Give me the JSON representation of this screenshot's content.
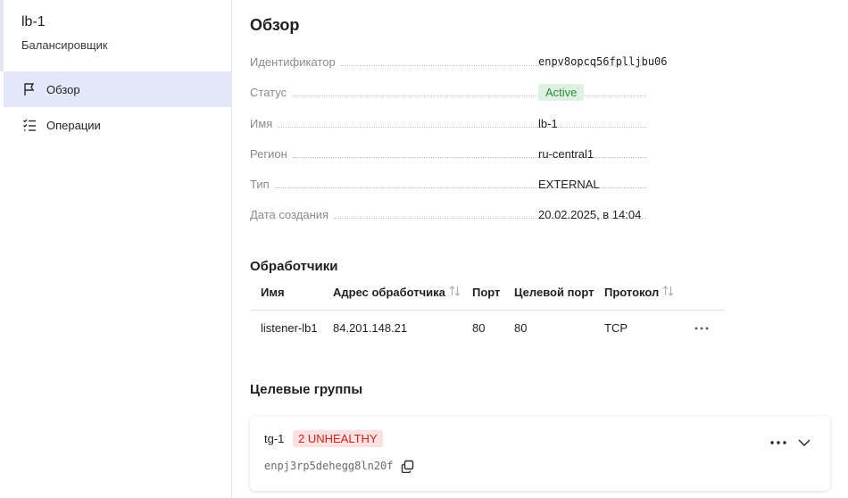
{
  "resource": {
    "name": "lb-1",
    "type_label": "Балансировщик"
  },
  "sidebar": {
    "items": [
      {
        "label": "Обзор",
        "icon": "flag-icon",
        "active": true
      },
      {
        "label": "Операции",
        "icon": "checklist-icon",
        "active": false
      }
    ]
  },
  "overview": {
    "title": "Обзор",
    "fields": [
      {
        "key": "Идентификатор",
        "value": "enpv8opcq56fplljbu06"
      },
      {
        "key": "Статус",
        "value": "Active"
      },
      {
        "key": "Имя",
        "value": "lb-1"
      },
      {
        "key": "Регион",
        "value": "ru-central1"
      },
      {
        "key": "Тип",
        "value": "EXTERNAL"
      },
      {
        "key": "Дата создания",
        "value": "20.02.2025, в 14:04"
      }
    ]
  },
  "listeners": {
    "title": "Обработчики",
    "columns": [
      "Имя",
      "Адрес обработчика",
      "Порт",
      "Целевой порт",
      "Протокол"
    ],
    "rows": [
      [
        "listener-lb1",
        "84.201.148.21",
        "80",
        "80",
        "TCP"
      ]
    ]
  },
  "target_groups": {
    "title": "Целевые группы",
    "items": [
      {
        "name": "tg-1",
        "status_badge": "2 UNHEALTHY",
        "id": "enpj3rp5dehegg8ln20f"
      }
    ]
  },
  "colors": {
    "active_nav_bg": "#e4e7f7",
    "status_active_bg": "#dff2e1",
    "status_active_fg": "#2c8a3e",
    "unhealthy_bg": "#fde1e1",
    "unhealthy_fg": "#d42020"
  }
}
